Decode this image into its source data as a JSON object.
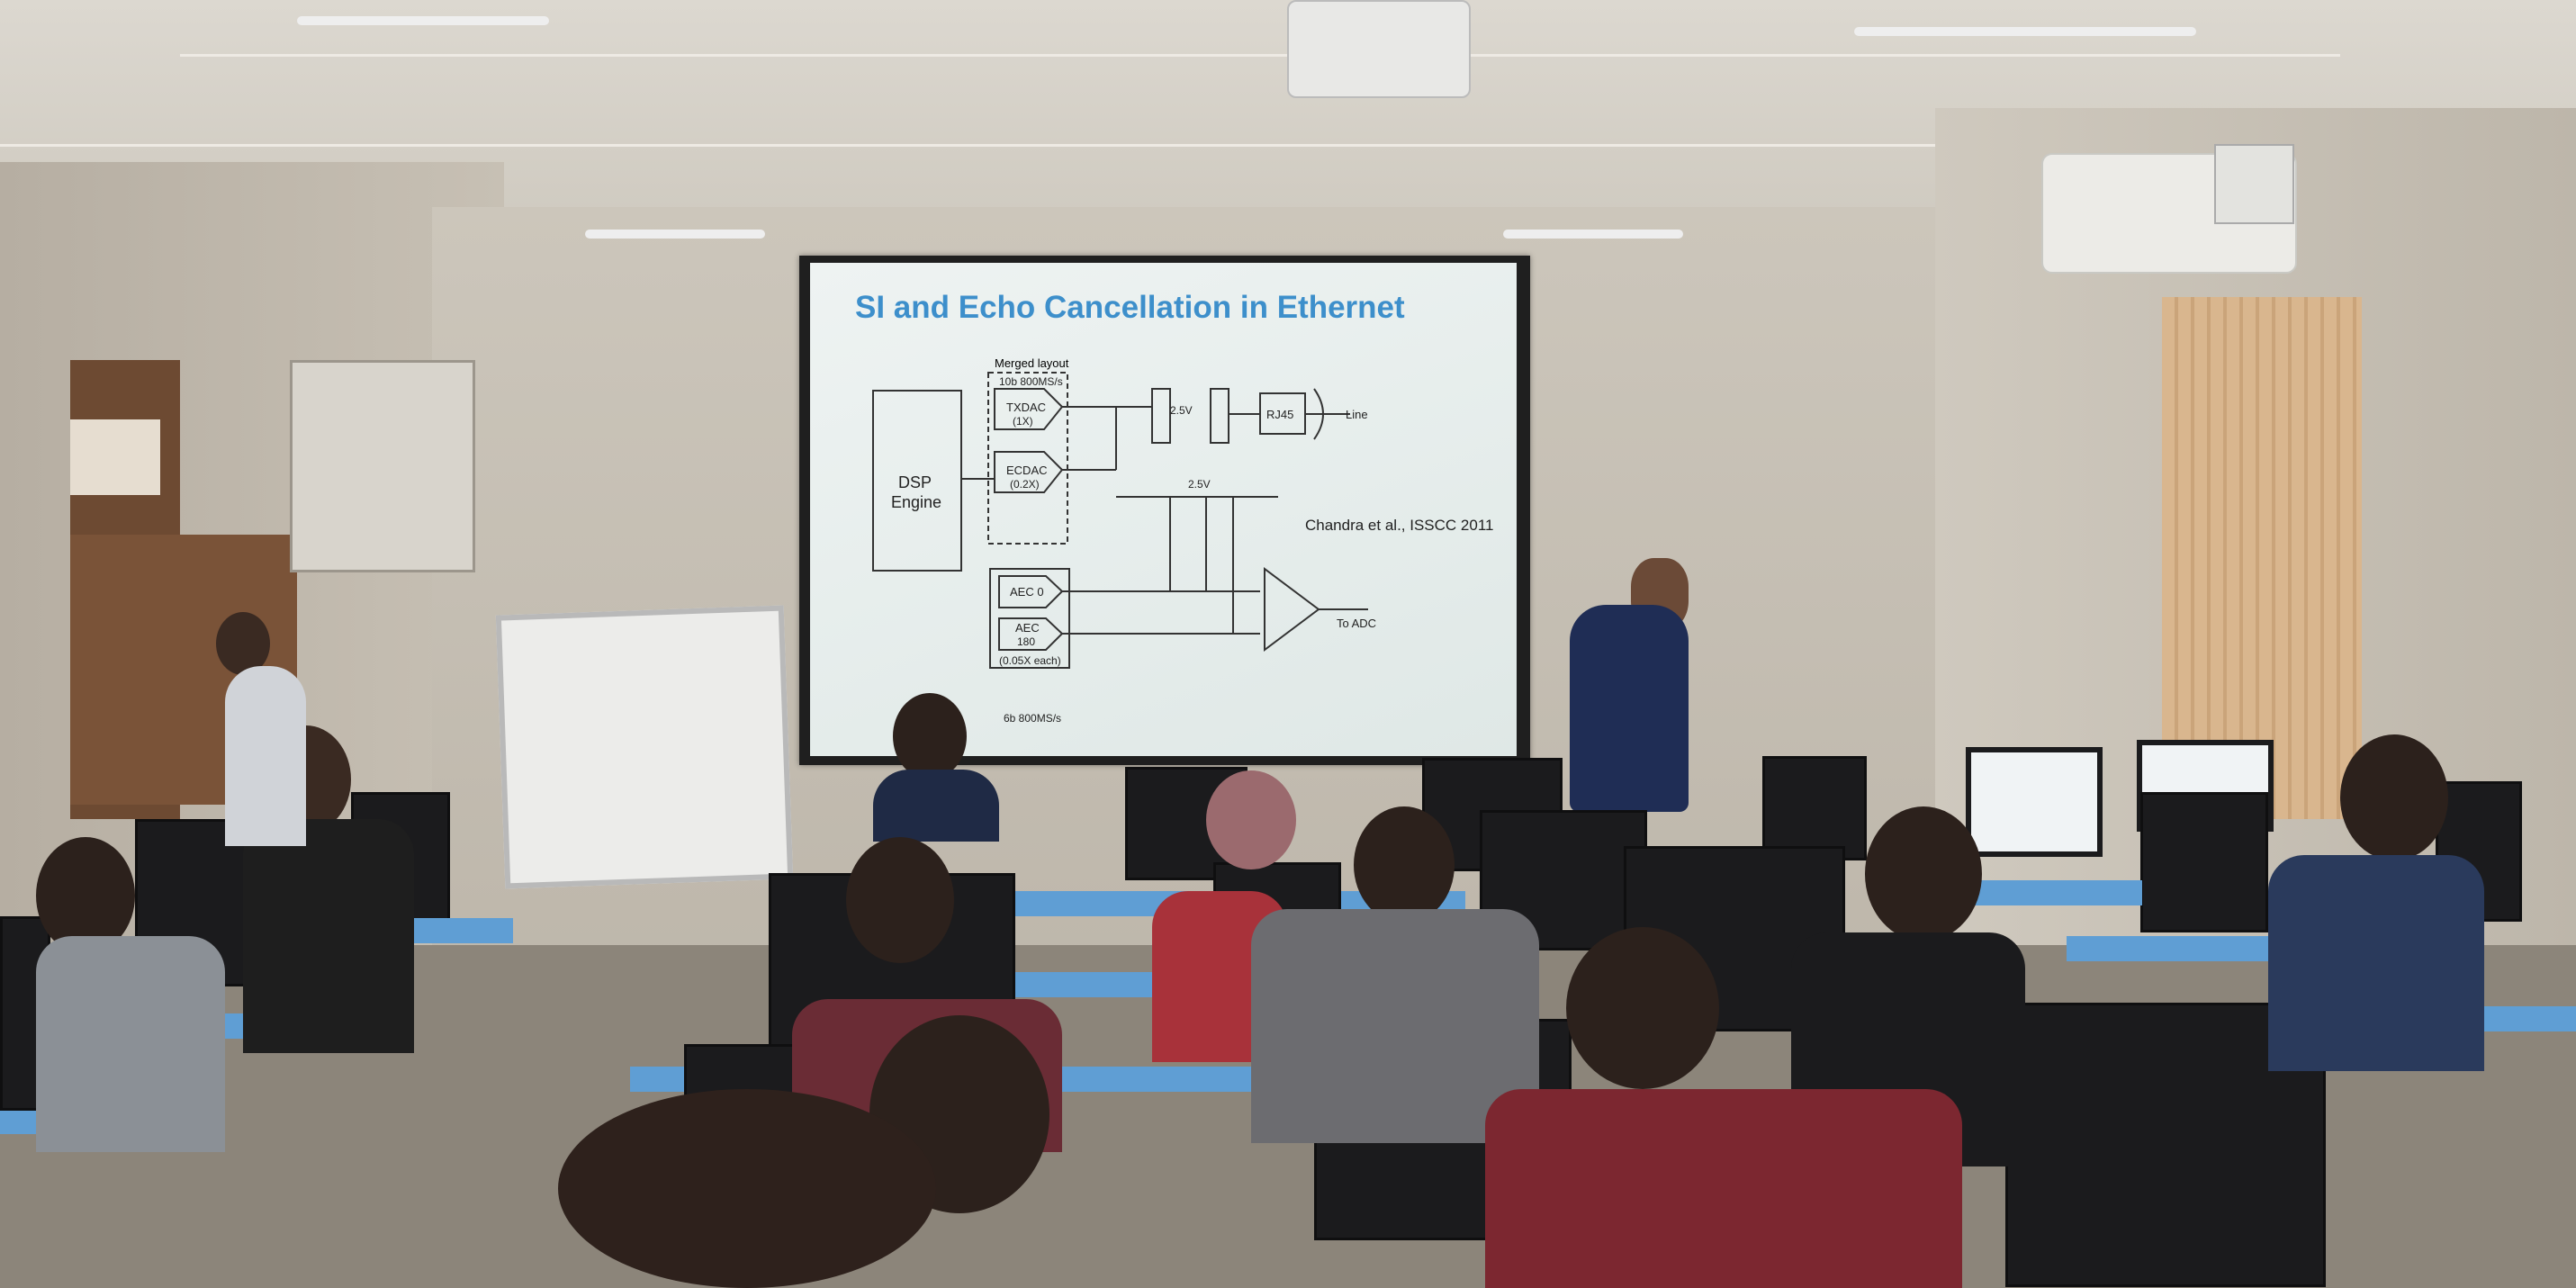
{
  "scene": {
    "description_colors": {
      "slide_title_color": "#3d8fcb",
      "desk_color": "#5f9ed4",
      "screen_border": "#1f1f1f"
    }
  },
  "slide": {
    "title": "SI and Echo Cancellation in Ethernet",
    "citation": "Chandra et al., ISSCC 2011",
    "labels": {
      "merged_layout": "Merged layout",
      "top_rate": "10b 800MS/s",
      "txdac": "TXDAC",
      "txdac_gain": "(1X)",
      "ecdac": "ECDAC",
      "ecdac_gain": "(0.2X)",
      "dsp": "DSP",
      "engine": "Engine",
      "aec0": "AEC 0",
      "aec": "AEC",
      "aec_num": "180",
      "aec_gain": "(0.05X each)",
      "bottom_rate": "6b 800MS/s",
      "v1": "2.5V",
      "v2": "2.5V",
      "rj45": "RJ45",
      "line": "Line",
      "to_adc": "To ADC"
    }
  }
}
